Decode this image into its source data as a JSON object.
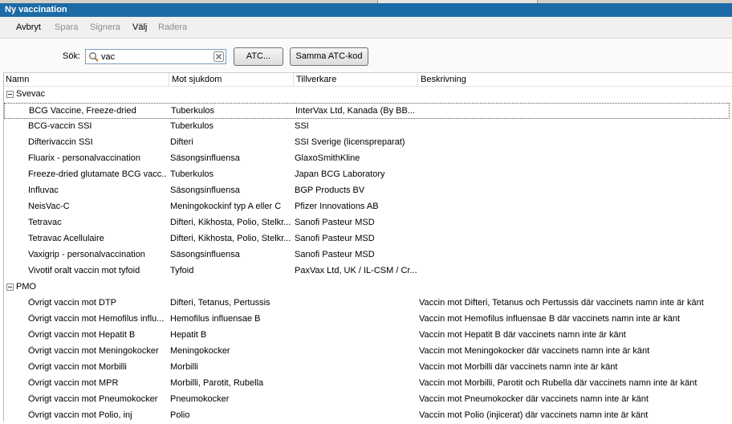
{
  "window": {
    "title": "Ny vaccination"
  },
  "toolbar": {
    "avbryt": "Avbryt",
    "spara": "Spara",
    "signera": "Signera",
    "valj": "Välj",
    "radera": "Radera"
  },
  "search": {
    "label": "Sök:",
    "value": "vac",
    "atc_button": "ATC...",
    "same_atc_button": "Samma ATC-kod"
  },
  "columns": {
    "name": "Namn",
    "disease": "Mot sjukdom",
    "manufacturer": "Tillverkare",
    "description": "Beskrivning"
  },
  "groups": [
    {
      "label": "Svevac",
      "rows": [
        {
          "name": "BCG Vaccine, Freeze-dried",
          "disease": "Tuberkulos",
          "manufacturer": "InterVax Ltd, Kanada (By BB...",
          "description": ""
        },
        {
          "name": "BCG-vaccin SSI",
          "disease": "Tuberkulos",
          "manufacturer": "SSI",
          "description": ""
        },
        {
          "name": "Difterivaccin SSI",
          "disease": "Difteri",
          "manufacturer": "SSI Sverige (licenspreparat)",
          "description": ""
        },
        {
          "name": "Fluarix - personalvaccination",
          "disease": "Säsongsinfluensa",
          "manufacturer": "GlaxoSmithKline",
          "description": ""
        },
        {
          "name": "Freeze-dried glutamate BCG vacc...",
          "disease": "Tuberkulos",
          "manufacturer": "Japan BCG Laboratory",
          "description": ""
        },
        {
          "name": "Influvac",
          "disease": "Säsongsinfluensa",
          "manufacturer": "BGP Products BV",
          "description": ""
        },
        {
          "name": "NeisVac-C",
          "disease": "Meningokockinf typ A eller C",
          "manufacturer": "Pfizer Innovations AB",
          "description": ""
        },
        {
          "name": "Tetravac",
          "disease": "Difteri, Kikhosta, Polio, Stelkr...",
          "manufacturer": "Sanofi Pasteur MSD",
          "description": ""
        },
        {
          "name": "Tetravac Acellulaire",
          "disease": "Difteri, Kikhosta, Polio, Stelkr...",
          "manufacturer": "Sanofi Pasteur MSD",
          "description": ""
        },
        {
          "name": "Vaxigrip - personalvaccination",
          "disease": "Säsongsinfluensa",
          "manufacturer": "Sanofi Pasteur MSD",
          "description": ""
        },
        {
          "name": "Vivotif oralt vaccin mot tyfoid",
          "disease": "Tyfoid",
          "manufacturer": "PaxVax Ltd, UK / IL-CSM / Cr...",
          "description": ""
        }
      ]
    },
    {
      "label": "PMO",
      "rows": [
        {
          "name": "Övrigt vaccin mot DTP",
          "disease": "Difteri, Tetanus, Pertussis",
          "manufacturer": "",
          "description": "Vaccin mot Difteri, Tetanus och Pertussis där vaccinets namn inte är känt"
        },
        {
          "name": "Övrigt vaccin mot Hemofilus influ...",
          "disease": "Hemofilus influensae B",
          "manufacturer": "",
          "description": "Vaccin mot Hemofilus influensae B där vaccinets namn inte är känt"
        },
        {
          "name": "Övrigt vaccin mot Hepatit B",
          "disease": "Hepatit B",
          "manufacturer": "",
          "description": "Vaccin mot Hepatit B där vaccinets namn inte är känt"
        },
        {
          "name": "Övrigt vaccin mot Meningokocker",
          "disease": "Meningokocker",
          "manufacturer": "",
          "description": "Vaccin mot Meningokocker där vaccinets namn inte är känt"
        },
        {
          "name": "Övrigt vaccin mot Morbilli",
          "disease": "Morbilli",
          "manufacturer": "",
          "description": "Vaccin mot Morbilli där vaccinets namn inte är känt"
        },
        {
          "name": "Övrigt vaccin mot MPR",
          "disease": "Morbilli, Parotit, Rubella",
          "manufacturer": "",
          "description": "Vaccin mot Morbilli, Parotit och Rubella där vaccinets namn inte är känt"
        },
        {
          "name": "Övrigt vaccin mot Pneumokocker",
          "disease": "Pneumokocker",
          "manufacturer": "",
          "description": "Vaccin mot Pneumokocker där vaccinets namn inte är känt"
        },
        {
          "name": "Övrigt vaccin mot Polio, inj",
          "disease": "Polio",
          "manufacturer": "",
          "description": "Vaccin mot Polio (injicerat) där vaccinets namn inte är känt"
        }
      ]
    }
  ]
}
